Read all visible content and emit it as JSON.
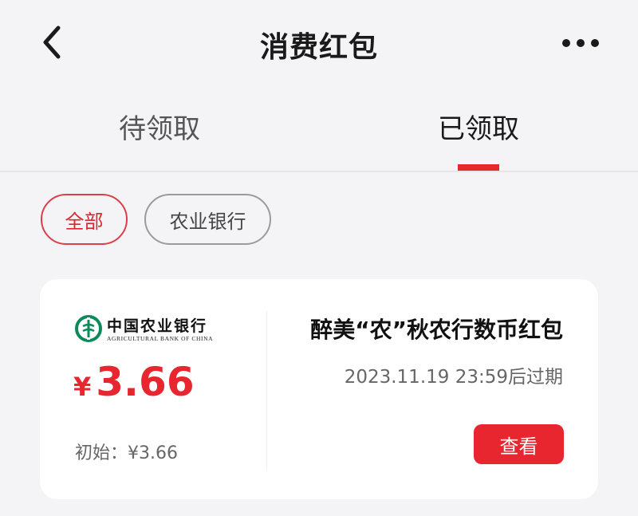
{
  "header": {
    "title": "消费红包",
    "back_icon": "chevron-left-icon",
    "more_icon": "more-horizontal-icon"
  },
  "tabs": [
    {
      "label": "待领取",
      "active": false
    },
    {
      "label": "已领取",
      "active": true
    }
  ],
  "filters": [
    {
      "label": "全部",
      "selected": true
    },
    {
      "label": "农业银行",
      "selected": false
    }
  ],
  "coupon": {
    "bank_name_cn": "中国农业银行",
    "bank_name_en": "AGRICULTURAL BANK OF CHINA",
    "currency_symbol": "¥",
    "amount": "3.66",
    "initial_label": "初始：¥3.66",
    "title": "醉美“农”秋农行数币红包",
    "expiry": "2023.11.19 23:59后过期",
    "view_label": "查看"
  },
  "colors": {
    "accent": "#e8262f",
    "background": "#f4f4f6",
    "card": "#ffffff",
    "bank_logo": "#0e8a5a"
  }
}
